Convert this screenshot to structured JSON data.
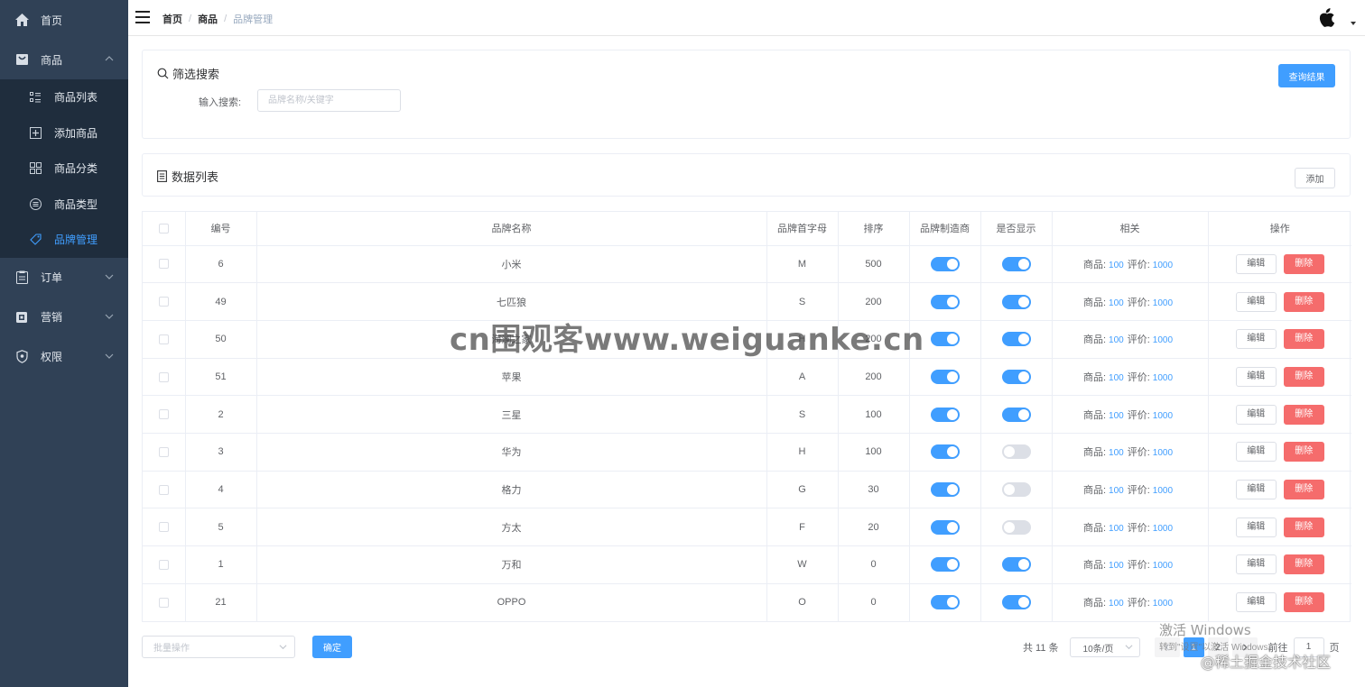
{
  "sidebar": {
    "items": [
      {
        "label": "首页",
        "icon": "home-icon"
      },
      {
        "label": "商品",
        "icon": "shopping-bag-icon",
        "expanded": true,
        "children": [
          {
            "label": "商品列表",
            "icon": "list-icon"
          },
          {
            "label": "添加商品",
            "icon": "add-square-icon"
          },
          {
            "label": "商品分类",
            "icon": "grid-icon"
          },
          {
            "label": "商品类型",
            "icon": "menu-circle-icon"
          },
          {
            "label": "品牌管理",
            "icon": "tag-icon",
            "active": true
          }
        ]
      },
      {
        "label": "订单",
        "icon": "clipboard-icon"
      },
      {
        "label": "营销",
        "icon": "coupon-icon"
      },
      {
        "label": "权限",
        "icon": "shield-icon"
      }
    ]
  },
  "header": {
    "breadcrumb": [
      "首页",
      "商品",
      "品牌管理"
    ],
    "avatar_icon": "apple-logo-icon"
  },
  "filter": {
    "title": "筛选搜索",
    "label": "输入搜索:",
    "placeholder": "品牌名称/关键字",
    "query_button": "查询结果"
  },
  "list": {
    "title": "数据列表",
    "add_button": "添加"
  },
  "table": {
    "columns": [
      "编号",
      "品牌名称",
      "品牌首字母",
      "排序",
      "品牌制造商",
      "是否显示",
      "相关",
      "操作"
    ],
    "related_product_label": "商品:",
    "related_review_label": "评价:",
    "edit_label": "编辑",
    "delete_label": "删除",
    "rows": [
      {
        "id": "6",
        "name": "小米",
        "letter": "M",
        "sort": "500",
        "factory": true,
        "show": true,
        "products": "100",
        "reviews": "1000"
      },
      {
        "id": "49",
        "name": "七匹狼",
        "letter": "S",
        "sort": "200",
        "factory": true,
        "show": true,
        "products": "100",
        "reviews": "1000"
      },
      {
        "id": "50",
        "name": "海澜之家",
        "letter": "H",
        "sort": "200",
        "factory": true,
        "show": true,
        "products": "100",
        "reviews": "1000"
      },
      {
        "id": "51",
        "name": "苹果",
        "letter": "A",
        "sort": "200",
        "factory": true,
        "show": true,
        "products": "100",
        "reviews": "1000"
      },
      {
        "id": "2",
        "name": "三星",
        "letter": "S",
        "sort": "100",
        "factory": true,
        "show": true,
        "products": "100",
        "reviews": "1000"
      },
      {
        "id": "3",
        "name": "华为",
        "letter": "H",
        "sort": "100",
        "factory": true,
        "show": false,
        "products": "100",
        "reviews": "1000"
      },
      {
        "id": "4",
        "name": "格力",
        "letter": "G",
        "sort": "30",
        "factory": true,
        "show": false,
        "products": "100",
        "reviews": "1000"
      },
      {
        "id": "5",
        "name": "方太",
        "letter": "F",
        "sort": "20",
        "factory": true,
        "show": false,
        "products": "100",
        "reviews": "1000"
      },
      {
        "id": "1",
        "name": "万和",
        "letter": "W",
        "sort": "0",
        "factory": true,
        "show": true,
        "products": "100",
        "reviews": "1000"
      },
      {
        "id": "21",
        "name": "OPPO",
        "letter": "O",
        "sort": "0",
        "factory": true,
        "show": true,
        "products": "100",
        "reviews": "1000"
      }
    ]
  },
  "footer": {
    "batch_placeholder": "批量操作",
    "confirm_button": "确定",
    "total_text": "共 11 条",
    "page_size": "10条/页",
    "pages": [
      "1",
      "2"
    ],
    "current_page": "1",
    "goto_label": "前往",
    "goto_value": "1",
    "goto_unit": "页"
  },
  "overlays": {
    "watermark": "cn围观客www.weiguanke.cn",
    "windows_activate": "激活 Windows",
    "windows_activate_sub": "转到\"设置\"以激活 Windows。",
    "juejin": "@稀土掘金技术社区"
  },
  "colors": {
    "sidebar_bg": "#304156",
    "submenu_bg": "#1f2d3d",
    "primary": "#409eff",
    "danger": "#f56c6c",
    "switch_off": "#dcdfe6"
  }
}
